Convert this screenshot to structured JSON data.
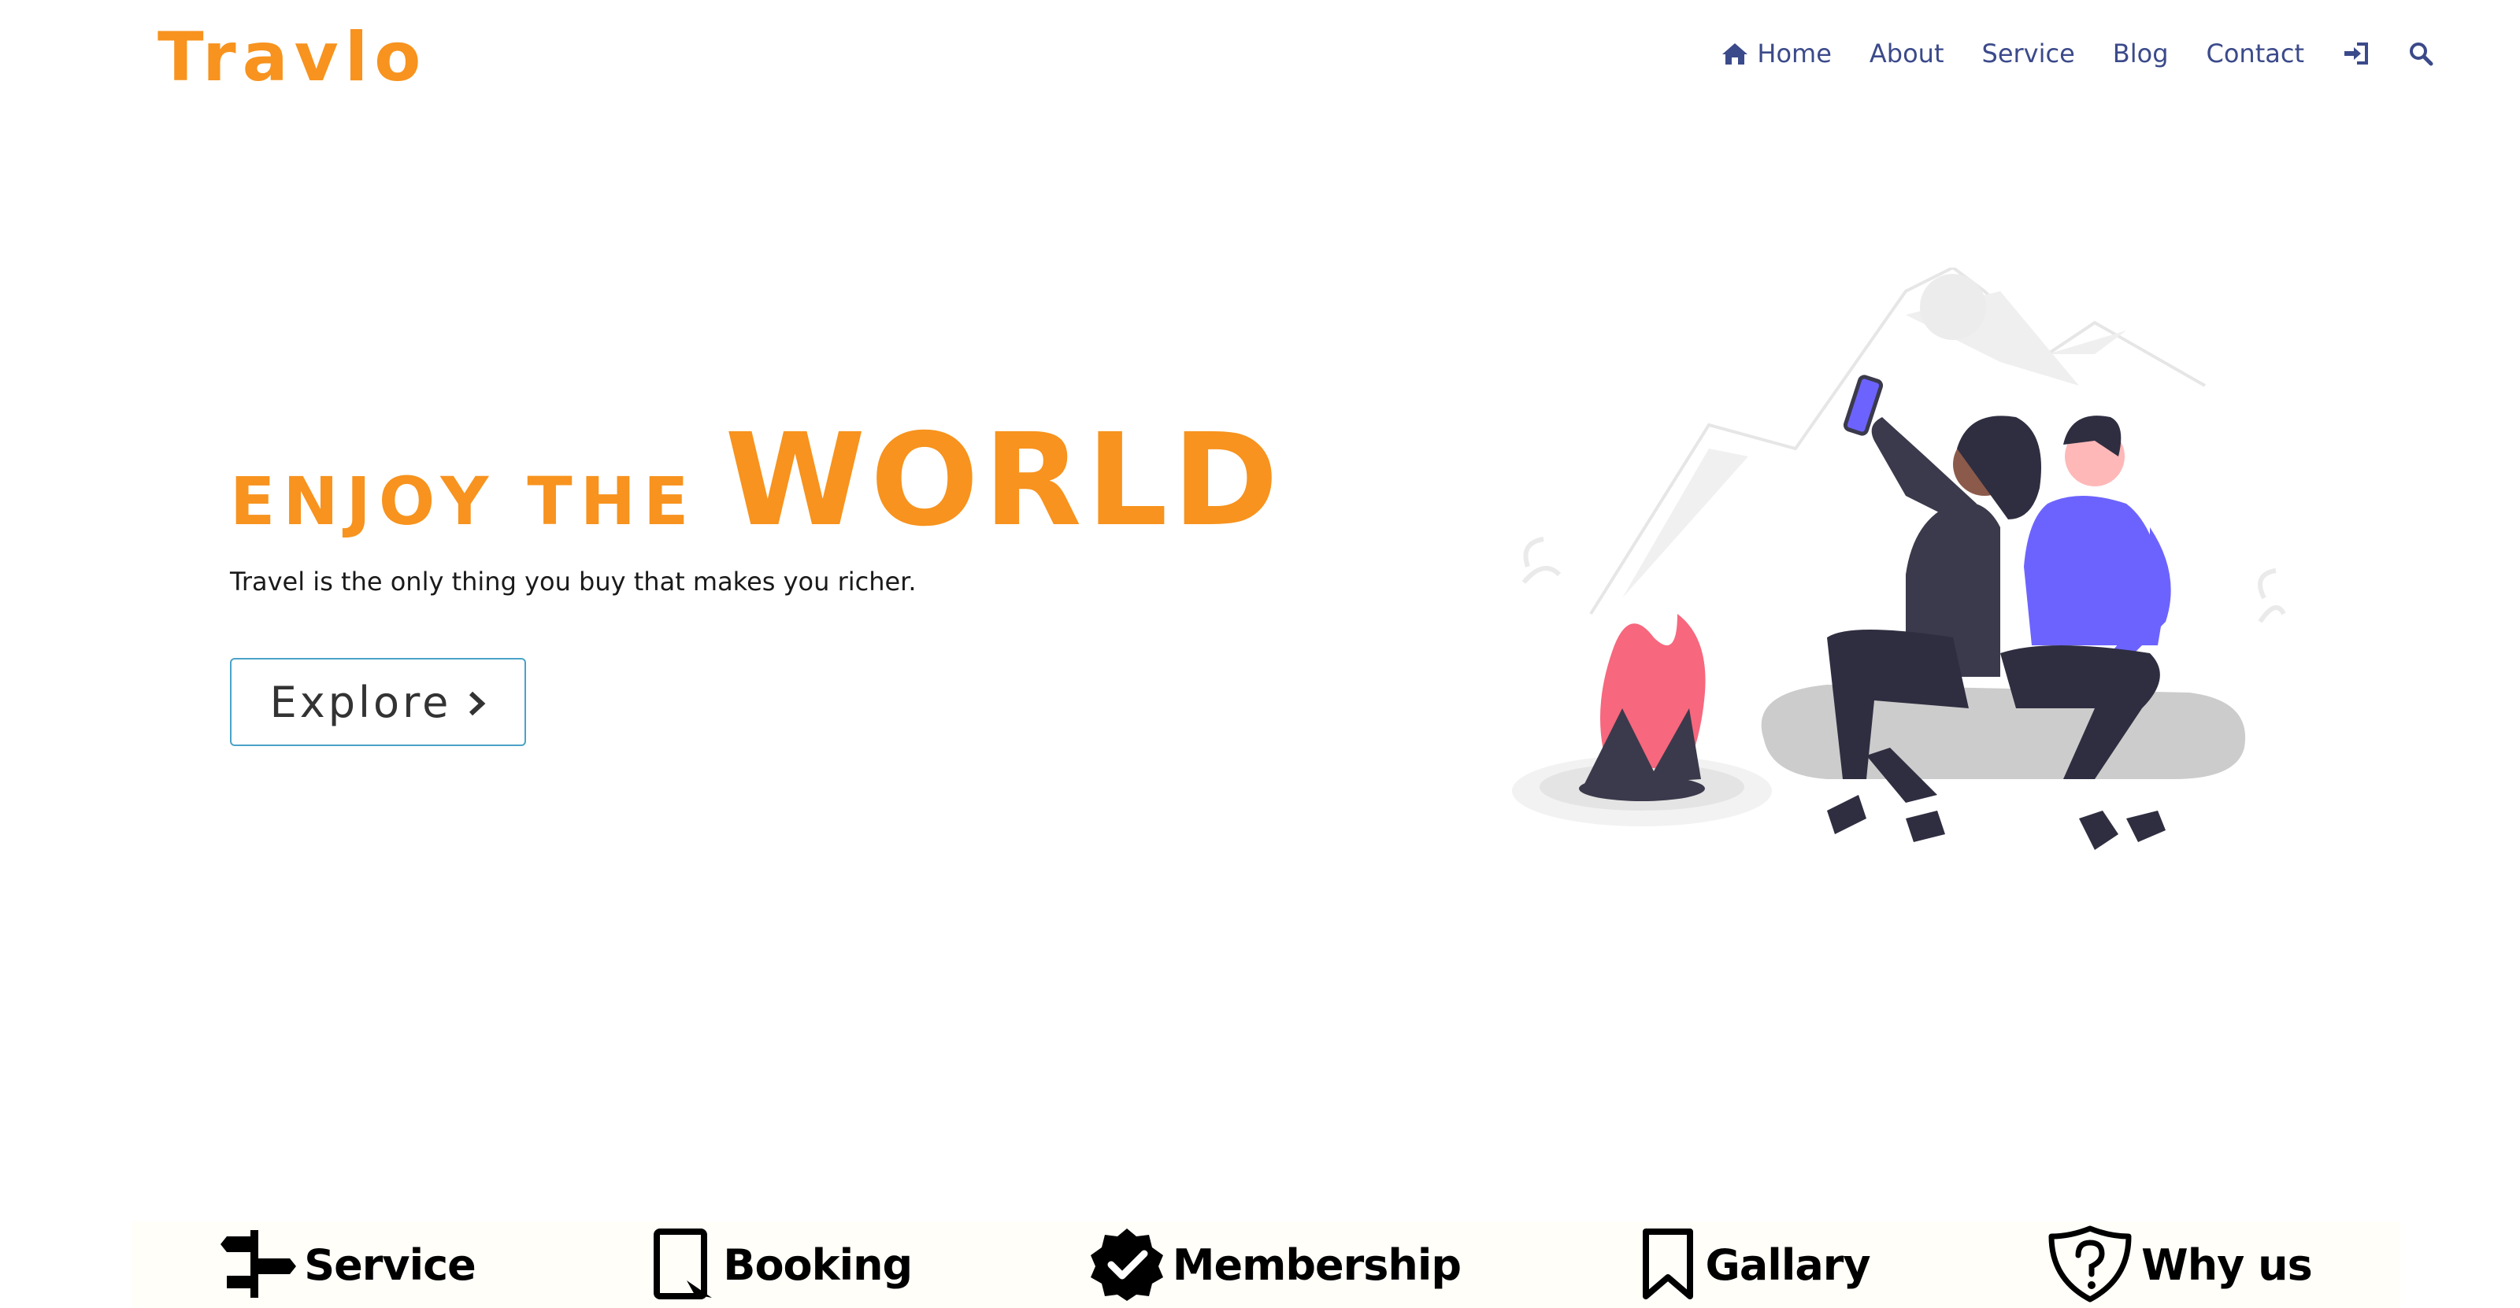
{
  "brand": {
    "logo": "Travlo",
    "accent": "#f7931e"
  },
  "nav": {
    "color": "#3b4a8a",
    "items": [
      {
        "label": "Home",
        "icon": "home-icon"
      },
      {
        "label": "About"
      },
      {
        "label": "Service"
      },
      {
        "label": "Blog"
      },
      {
        "label": "Contact"
      }
    ],
    "login_icon": "sign-in-icon",
    "search_icon": "search-icon"
  },
  "hero": {
    "title_small": "ENJOY THE",
    "title_big": "WORLD",
    "subtitle": "Travel is the only thing you buy that makes you richer.",
    "button_label": "Explore",
    "button_icon": "chevron-right-icon"
  },
  "features": [
    {
      "label": "Service",
      "icon": "signpost-icon"
    },
    {
      "label": "Booking",
      "icon": "tablet-icon"
    },
    {
      "label": "Membership",
      "icon": "verified-badge-icon"
    },
    {
      "label": "Gallary",
      "icon": "bookmark-icon"
    },
    {
      "label": "Why us",
      "icon": "shield-question-icon"
    }
  ]
}
